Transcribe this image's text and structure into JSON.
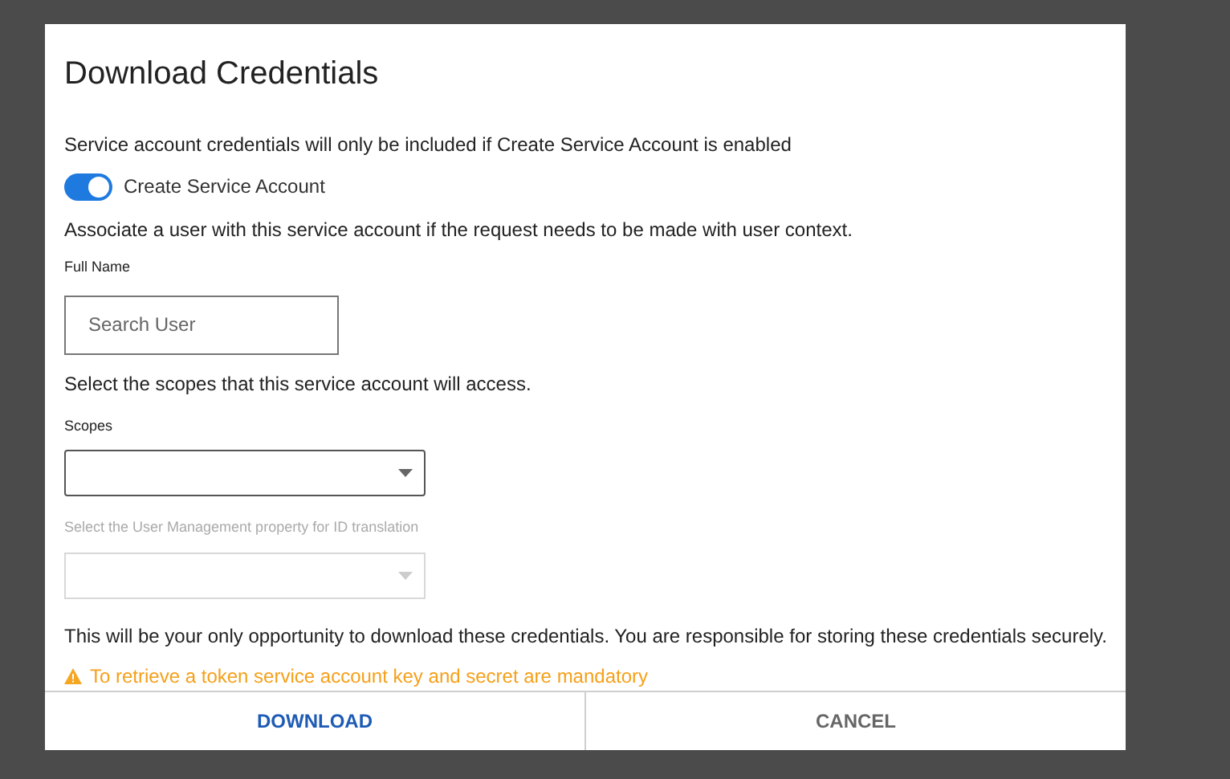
{
  "dialog": {
    "title": "Download Credentials",
    "notice": "Service account credentials will only be included if Create Service Account is enabled",
    "toggle": {
      "label": "Create Service Account",
      "on": true
    },
    "associate_text": "Associate a user with this service account if the request needs to be made with user context.",
    "full_name": {
      "label": "Full Name",
      "placeholder": "Search User"
    },
    "scopes_text": "Select the scopes that this service account will access.",
    "scopes": {
      "label": "Scopes",
      "disabled": false
    },
    "property": {
      "label": "Select the User Management property for ID translation",
      "disabled": true
    },
    "responsibility_text": "This will be your only opportunity to download these credentials. You are responsible for storing these credentials securely.",
    "warning": "To retrieve a token service account key and secret are mandatory",
    "buttons": [
      {
        "label": "DOWNLOAD",
        "kind": "primary"
      },
      {
        "label": "CANCEL",
        "kind": "secondary"
      }
    ]
  }
}
